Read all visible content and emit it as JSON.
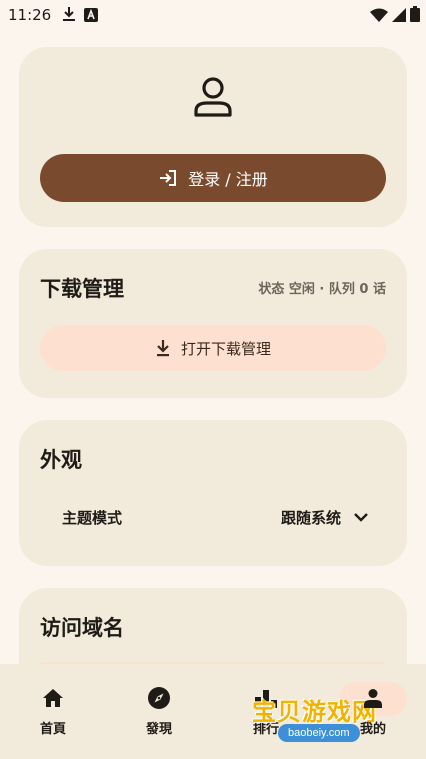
{
  "status_bar": {
    "time": "11:26",
    "left_icons": [
      "download-icon",
      "app-a-icon"
    ],
    "right_icons": [
      "wifi-icon",
      "signal-icon",
      "battery-icon"
    ]
  },
  "account_card": {
    "avatar_icon": "person-icon",
    "login_button_label": "登录 / 注册",
    "login_icon": "login-arrow-icon"
  },
  "download_card": {
    "title": "下载管理",
    "status": "状态 空闲 · 队列 0 话",
    "open_button_label": "打开下载管理",
    "open_icon": "download-icon"
  },
  "appearance_card": {
    "title": "外观",
    "theme_label": "主题模式",
    "theme_value": "跟随系统",
    "theme_icon": "chevron-down-icon"
  },
  "domain_card": {
    "title": "访问域名"
  },
  "bottom_nav": {
    "items": [
      {
        "label": "首頁",
        "icon": "home-icon"
      },
      {
        "label": "發現",
        "icon": "compass-icon"
      },
      {
        "label": "排行",
        "icon": "ranking-icon"
      },
      {
        "label": "我的",
        "icon": "person-icon",
        "selected": true
      }
    ]
  },
  "watermark": {
    "text": "宝贝游戏网",
    "url": "baobeiy.com"
  },
  "colors": {
    "background": "#fbf5ee",
    "card": "#f2eadb",
    "primary": "#7a4a2e",
    "tonal": "#fde0cf"
  }
}
